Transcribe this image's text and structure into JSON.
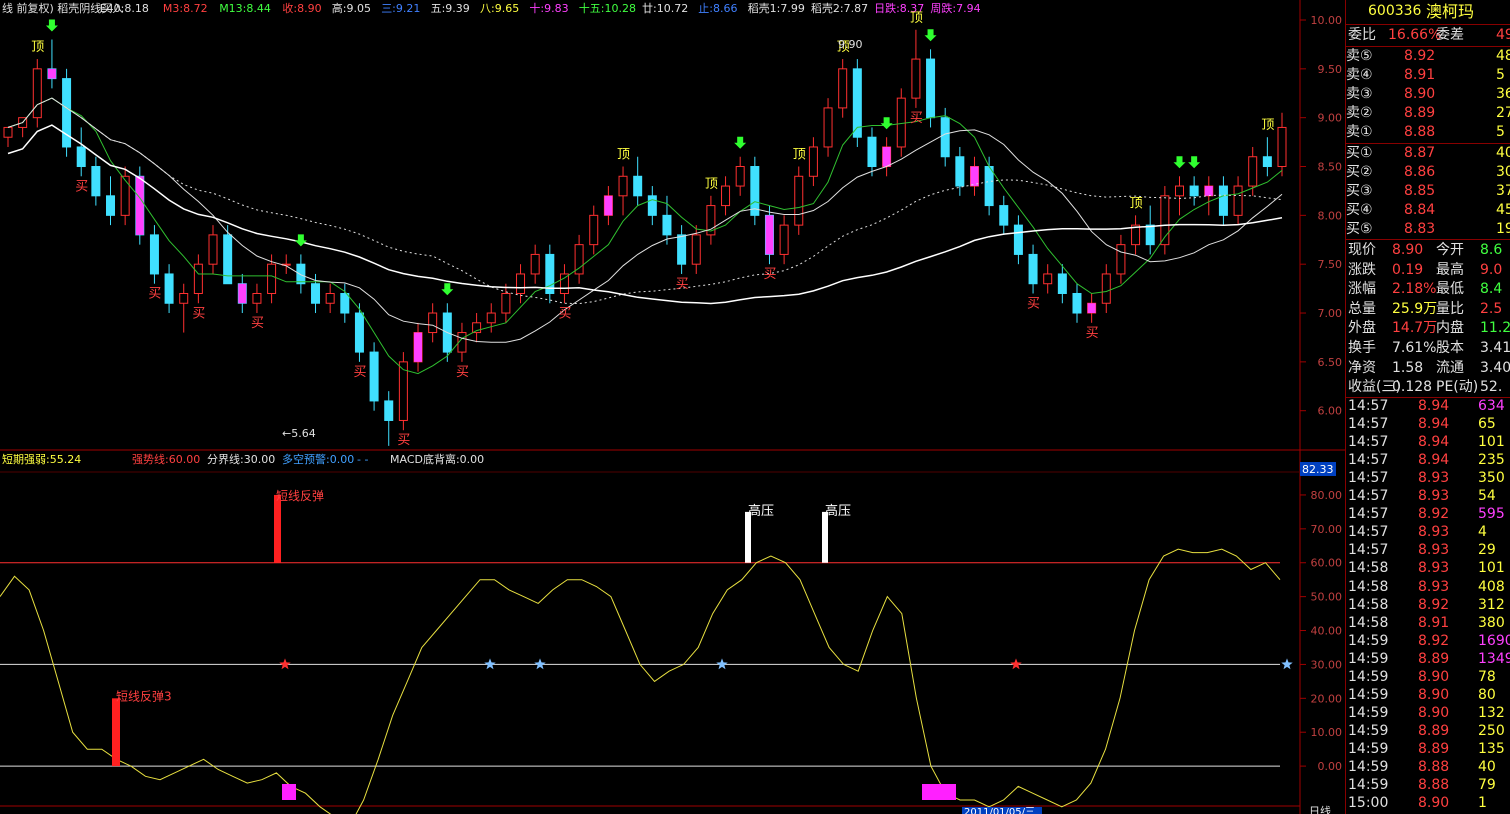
{
  "header": {
    "items": [
      {
        "text": "线 前复权) 稻壳阴线买入",
        "color": "#e0e0e0"
      },
      {
        "text": "E40:8.18",
        "color": "#e0e0e0"
      },
      {
        "text": "M3:8.72",
        "color": "#ff4040"
      },
      {
        "text": "M13:8.44",
        "color": "#40ff40"
      },
      {
        "text": "收:8.90",
        "color": "#ff4040"
      },
      {
        "text": "高:9.05",
        "color": "#e0e0e0"
      },
      {
        "text": "三:9.21",
        "color": "#4080ff"
      },
      {
        "text": "五:9.39",
        "color": "#e0e0e0"
      },
      {
        "text": "八:9.65",
        "color": "#ffff40"
      },
      {
        "text": "十:9.83",
        "color": "#ff40ff"
      },
      {
        "text": "十五:10.28",
        "color": "#40ff40"
      },
      {
        "text": "廿:10.72",
        "color": "#e0e0e0"
      },
      {
        "text": "止:8.66",
        "color": "#4080ff"
      },
      {
        "text": "稻壳1:7.99",
        "color": "#e0e0e0"
      },
      {
        "text": "稻壳2:7.87",
        "color": "#e0e0e0"
      },
      {
        "text": "日跌:8.37",
        "color": "#ff40ff"
      },
      {
        "text": "周跌:7.94",
        "color": "#ff40ff"
      }
    ]
  },
  "indicator_header": {
    "items": [
      {
        "text": "短期强弱:55.24",
        "color": "#ffff40"
      },
      {
        "text": "强势线:60.00",
        "color": "#ff4040"
      },
      {
        "text": "分界线:30.00",
        "color": "#e0e0e0"
      },
      {
        "text": "多空预警:0.00",
        "color": "#40a0ff"
      },
      {
        "text": "- -",
        "color": "#40a0ff"
      },
      {
        "text": "MACD底背离:0.00",
        "color": "#e0e0e0"
      }
    ]
  },
  "price_axis": [
    "10.00",
    "9.50",
    "9.00",
    "8.50",
    "8.00",
    "7.50",
    "7.00",
    "6.50",
    "6.00"
  ],
  "indicator_axis": [
    "80.00",
    "70.00",
    "60.00",
    "50.00",
    "40.00",
    "30.00",
    "20.00",
    "10.00",
    "0.00"
  ],
  "indicator_current": "82.33",
  "annotations": {
    "top": "顶",
    "buy": "买",
    "low_price": "←5.64",
    "high_price": "9.90",
    "short_rebound": "短线反弹",
    "short_rebound3": "短线反弹3",
    "high_pressure": "高压"
  },
  "bottom_date": "2011/01/05/三",
  "bottom_right_label": "日线",
  "stock": {
    "code": "600336",
    "name": "澳柯玛"
  },
  "order_book": {
    "wei_label": "委比",
    "wei_value": "16.66%",
    "cha_label": "委差",
    "cha_value": "49",
    "sell": [
      {
        "label": "卖⑤",
        "price": "8.92",
        "vol": "48"
      },
      {
        "label": "卖④",
        "price": "8.91",
        "vol": "5"
      },
      {
        "label": "卖③",
        "price": "8.90",
        "vol": "36"
      },
      {
        "label": "卖②",
        "price": "8.89",
        "vol": "27"
      },
      {
        "label": "卖①",
        "price": "8.88",
        "vol": "5"
      }
    ],
    "buy": [
      {
        "label": "买①",
        "price": "8.87",
        "vol": "40"
      },
      {
        "label": "买②",
        "price": "8.86",
        "vol": "30"
      },
      {
        "label": "买③",
        "price": "8.85",
        "vol": "37"
      },
      {
        "label": "买④",
        "price": "8.84",
        "vol": "45"
      },
      {
        "label": "买⑤",
        "price": "8.83",
        "vol": "19"
      }
    ]
  },
  "quote": [
    {
      "l1": "现价",
      "v1": "8.90",
      "c1": "#ff4040",
      "l2": "今开",
      "v2": "8.6",
      "c2": "#40ff40"
    },
    {
      "l1": "涨跌",
      "v1": "0.19",
      "c1": "#ff4040",
      "l2": "最高",
      "v2": "9.0",
      "c2": "#ff4040"
    },
    {
      "l1": "涨幅",
      "v1": "2.18%",
      "c1": "#ff4040",
      "l2": "最低",
      "v2": "8.4",
      "c2": "#40ff40"
    },
    {
      "l1": "总量",
      "v1": "25.9万",
      "c1": "#ffff40",
      "l2": "量比",
      "v2": "2.5",
      "c2": "#ff4040"
    },
    {
      "l1": "外盘",
      "v1": "14.7万",
      "c1": "#ff4040",
      "l2": "内盘",
      "v2": "11.2万",
      "c2": "#40ff40"
    },
    {
      "l1": "换手",
      "v1": "7.61%",
      "c1": "#e0e0e0",
      "l2": "股本",
      "v2": "3.41亿",
      "c2": "#e0e0e0"
    },
    {
      "l1": "净资",
      "v1": "1.58",
      "c1": "#e0e0e0",
      "l2": "流通",
      "v2": "3.40亿",
      "c2": "#e0e0e0"
    },
    {
      "l1": "收益(三)",
      "v1": "0.128",
      "c1": "#e0e0e0",
      "l2": "PE(动)",
      "v2": "52.",
      "c2": "#e0e0e0"
    }
  ],
  "ticks": [
    {
      "time": "14:57",
      "price": "8.94",
      "vol": "634",
      "c": "#ff40ff"
    },
    {
      "time": "14:57",
      "price": "8.94",
      "vol": "65",
      "c": "#ffff40"
    },
    {
      "time": "14:57",
      "price": "8.94",
      "vol": "101",
      "c": "#ffff40"
    },
    {
      "time": "14:57",
      "price": "8.94",
      "vol": "235",
      "c": "#ffff40"
    },
    {
      "time": "14:57",
      "price": "8.93",
      "vol": "350",
      "c": "#ffff40"
    },
    {
      "time": "14:57",
      "price": "8.93",
      "vol": "54",
      "c": "#ffff40"
    },
    {
      "time": "14:57",
      "price": "8.92",
      "vol": "595",
      "c": "#ff40ff"
    },
    {
      "time": "14:57",
      "price": "8.93",
      "vol": "4",
      "c": "#ffff40"
    },
    {
      "time": "14:57",
      "price": "8.93",
      "vol": "29",
      "c": "#ffff40"
    },
    {
      "time": "14:58",
      "price": "8.93",
      "vol": "101",
      "c": "#ffff40"
    },
    {
      "time": "14:58",
      "price": "8.93",
      "vol": "408",
      "c": "#ffff40"
    },
    {
      "time": "14:58",
      "price": "8.92",
      "vol": "312",
      "c": "#ffff40"
    },
    {
      "time": "14:58",
      "price": "8.91",
      "vol": "380",
      "c": "#ffff40"
    },
    {
      "time": "14:59",
      "price": "8.92",
      "vol": "1690",
      "c": "#ff40ff"
    },
    {
      "time": "14:59",
      "price": "8.89",
      "vol": "1349",
      "c": "#ff40ff"
    },
    {
      "time": "14:59",
      "price": "8.90",
      "vol": "78",
      "c": "#ffff40"
    },
    {
      "time": "14:59",
      "price": "8.90",
      "vol": "80",
      "c": "#ffff40"
    },
    {
      "time": "14:59",
      "price": "8.90",
      "vol": "132",
      "c": "#ffff40"
    },
    {
      "time": "14:59",
      "price": "8.89",
      "vol": "250",
      "c": "#ffff40"
    },
    {
      "time": "14:59",
      "price": "8.89",
      "vol": "135",
      "c": "#ffff40"
    },
    {
      "time": "14:59",
      "price": "8.88",
      "vol": "40",
      "c": "#ffff40"
    },
    {
      "time": "14:59",
      "price": "8.88",
      "vol": "79",
      "c": "#ffff40"
    },
    {
      "time": "15:00",
      "price": "8.90",
      "vol": "1",
      "c": "#ffff40"
    }
  ],
  "chart_data": {
    "type": "candlestick",
    "price_range": [
      5.7,
      10.0
    ],
    "candles": [
      [
        8.8,
        8.9,
        8.7,
        8.9
      ],
      [
        8.9,
        9.0,
        8.8,
        9.0
      ],
      [
        9.0,
        9.6,
        8.9,
        9.5
      ],
      [
        9.5,
        9.8,
        9.3,
        9.4
      ],
      [
        9.4,
        9.5,
        8.6,
        8.7
      ],
      [
        8.7,
        8.9,
        8.4,
        8.5
      ],
      [
        8.5,
        8.6,
        8.1,
        8.2
      ],
      [
        8.2,
        8.4,
        7.9,
        8.0
      ],
      [
        8.0,
        8.5,
        7.9,
        8.4
      ],
      [
        8.4,
        8.5,
        7.7,
        7.8
      ],
      [
        7.8,
        7.9,
        7.3,
        7.4
      ],
      [
        7.4,
        7.5,
        7.0,
        7.1
      ],
      [
        7.1,
        7.3,
        6.8,
        7.2
      ],
      [
        7.2,
        7.6,
        7.1,
        7.5
      ],
      [
        7.5,
        7.9,
        7.4,
        7.8
      ],
      [
        7.8,
        7.9,
        7.3,
        7.3
      ],
      [
        7.3,
        7.4,
        7.0,
        7.1
      ],
      [
        7.1,
        7.3,
        7.0,
        7.2
      ],
      [
        7.2,
        7.6,
        7.1,
        7.5
      ],
      [
        7.5,
        7.6,
        7.4,
        7.5
      ],
      [
        7.5,
        7.6,
        7.2,
        7.3
      ],
      [
        7.3,
        7.4,
        7.0,
        7.1
      ],
      [
        7.1,
        7.3,
        7.0,
        7.2
      ],
      [
        7.2,
        7.3,
        6.9,
        7.0
      ],
      [
        7.0,
        7.1,
        6.5,
        6.6
      ],
      [
        6.6,
        6.7,
        6.0,
        6.1
      ],
      [
        6.1,
        6.2,
        5.64,
        5.9
      ],
      [
        5.9,
        6.6,
        5.8,
        6.5
      ],
      [
        6.5,
        6.9,
        6.4,
        6.8
      ],
      [
        6.8,
        7.1,
        6.7,
        7.0
      ],
      [
        7.0,
        7.1,
        6.5,
        6.6
      ],
      [
        6.6,
        6.9,
        6.5,
        6.8
      ],
      [
        6.8,
        7.0,
        6.7,
        6.9
      ],
      [
        6.9,
        7.1,
        6.8,
        7.0
      ],
      [
        7.0,
        7.3,
        6.9,
        7.2
      ],
      [
        7.2,
        7.5,
        7.1,
        7.4
      ],
      [
        7.4,
        7.7,
        7.3,
        7.6
      ],
      [
        7.6,
        7.7,
        7.1,
        7.2
      ],
      [
        7.2,
        7.5,
        7.1,
        7.4
      ],
      [
        7.4,
        7.8,
        7.3,
        7.7
      ],
      [
        7.7,
        8.1,
        7.6,
        8.0
      ],
      [
        8.0,
        8.3,
        7.9,
        8.2
      ],
      [
        8.2,
        8.5,
        8.0,
        8.4
      ],
      [
        8.4,
        8.6,
        8.1,
        8.2
      ],
      [
        8.2,
        8.3,
        7.9,
        8.0
      ],
      [
        8.0,
        8.2,
        7.7,
        7.8
      ],
      [
        7.8,
        7.9,
        7.4,
        7.5
      ],
      [
        7.5,
        7.9,
        7.4,
        7.8
      ],
      [
        7.8,
        8.2,
        7.7,
        8.1
      ],
      [
        8.1,
        8.4,
        8.0,
        8.3
      ],
      [
        8.3,
        8.6,
        8.2,
        8.5
      ],
      [
        8.5,
        8.6,
        7.9,
        8.0
      ],
      [
        8.0,
        8.1,
        7.5,
        7.6
      ],
      [
        7.6,
        8.0,
        7.5,
        7.9
      ],
      [
        7.9,
        8.5,
        7.8,
        8.4
      ],
      [
        8.4,
        8.8,
        8.3,
        8.7
      ],
      [
        8.7,
        9.2,
        8.6,
        9.1
      ],
      [
        9.1,
        9.6,
        9.0,
        9.5
      ],
      [
        9.5,
        9.6,
        8.7,
        8.8
      ],
      [
        8.8,
        8.9,
        8.4,
        8.5
      ],
      [
        8.5,
        8.8,
        8.4,
        8.7
      ],
      [
        8.7,
        9.3,
        8.6,
        9.2
      ],
      [
        9.2,
        9.9,
        9.1,
        9.6
      ],
      [
        9.6,
        9.7,
        8.9,
        9.0
      ],
      [
        9.0,
        9.1,
        8.5,
        8.6
      ],
      [
        8.6,
        8.7,
        8.2,
        8.3
      ],
      [
        8.3,
        8.6,
        8.2,
        8.5
      ],
      [
        8.5,
        8.6,
        8.0,
        8.1
      ],
      [
        8.1,
        8.2,
        7.8,
        7.9
      ],
      [
        7.9,
        8.0,
        7.5,
        7.6
      ],
      [
        7.6,
        7.7,
        7.2,
        7.3
      ],
      [
        7.3,
        7.5,
        7.2,
        7.4
      ],
      [
        7.4,
        7.5,
        7.1,
        7.2
      ],
      [
        7.2,
        7.3,
        6.9,
        7.0
      ],
      [
        7.0,
        7.2,
        6.9,
        7.1
      ],
      [
        7.1,
        7.5,
        7.0,
        7.4
      ],
      [
        7.4,
        7.8,
        7.3,
        7.7
      ],
      [
        7.7,
        8.0,
        7.6,
        7.9
      ],
      [
        7.9,
        8.1,
        7.6,
        7.7
      ],
      [
        7.7,
        8.3,
        7.6,
        8.2
      ],
      [
        8.2,
        8.4,
        8.0,
        8.3
      ],
      [
        8.3,
        8.4,
        8.1,
        8.2
      ],
      [
        8.2,
        8.4,
        8.0,
        8.3
      ],
      [
        8.3,
        8.4,
        7.9,
        8.0
      ],
      [
        8.0,
        8.4,
        7.9,
        8.3
      ],
      [
        8.3,
        8.7,
        8.2,
        8.6
      ],
      [
        8.6,
        8.8,
        8.4,
        8.5
      ],
      [
        8.5,
        9.05,
        8.4,
        8.9
      ]
    ],
    "ma_levels": [
      7.6,
      7.9,
      8.2
    ],
    "indicator": {
      "name": "短期强弱",
      "range": [
        -10,
        85
      ],
      "values": [
        50,
        56,
        52,
        40,
        25,
        10,
        5,
        5,
        2,
        0,
        -3,
        -4,
        -2,
        0,
        2,
        -1,
        -3,
        -5,
        -4,
        -2,
        -6,
        -8,
        -12,
        -15,
        -18,
        -10,
        2,
        15,
        25,
        35,
        40,
        45,
        50,
        55,
        55,
        52,
        50,
        48,
        52,
        55,
        55,
        53,
        50,
        40,
        30,
        25,
        28,
        30,
        35,
        45,
        52,
        55,
        60,
        62,
        60,
        55,
        45,
        35,
        30,
        28,
        40,
        50,
        45,
        20,
        0,
        -8,
        -10,
        -10,
        -12,
        -10,
        -6,
        -8,
        -10,
        -12,
        -10,
        -5,
        5,
        20,
        40,
        55,
        62,
        64,
        63,
        63,
        64,
        62,
        58,
        60,
        55
      ]
    }
  }
}
